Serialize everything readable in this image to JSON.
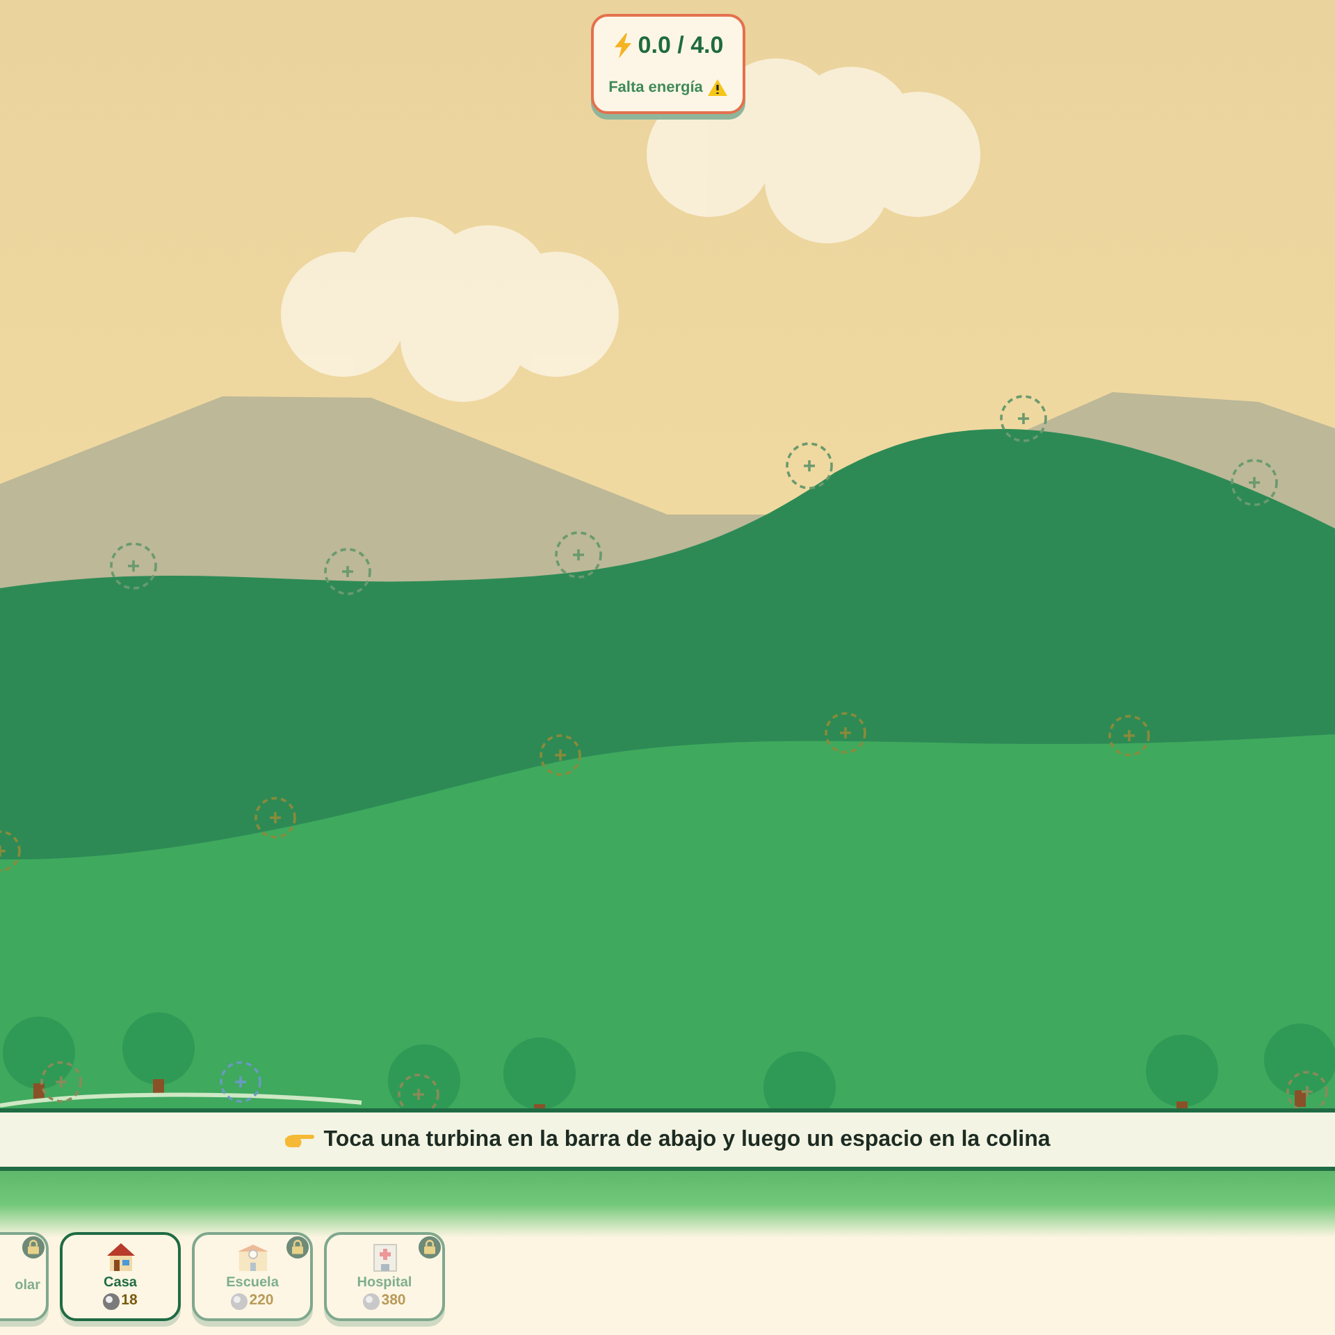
{
  "energy": {
    "reading": "0.0 / 4.0",
    "warning": "Falta energía"
  },
  "instruction": "Toca una turbina en la barra de abajo y luego un espacio en la colina",
  "tray": [
    {
      "kind": "solar",
      "name": "olar",
      "locked": true,
      "selected": false
    },
    {
      "kind": "house",
      "name": "Casa",
      "price": "18",
      "locked": false,
      "selected": true
    },
    {
      "kind": "school",
      "name": "Escuela",
      "price": "220",
      "locked": true,
      "selected": false
    },
    {
      "kind": "hospital",
      "name": "Hospital",
      "price": "380",
      "locked": true,
      "selected": false
    }
  ]
}
